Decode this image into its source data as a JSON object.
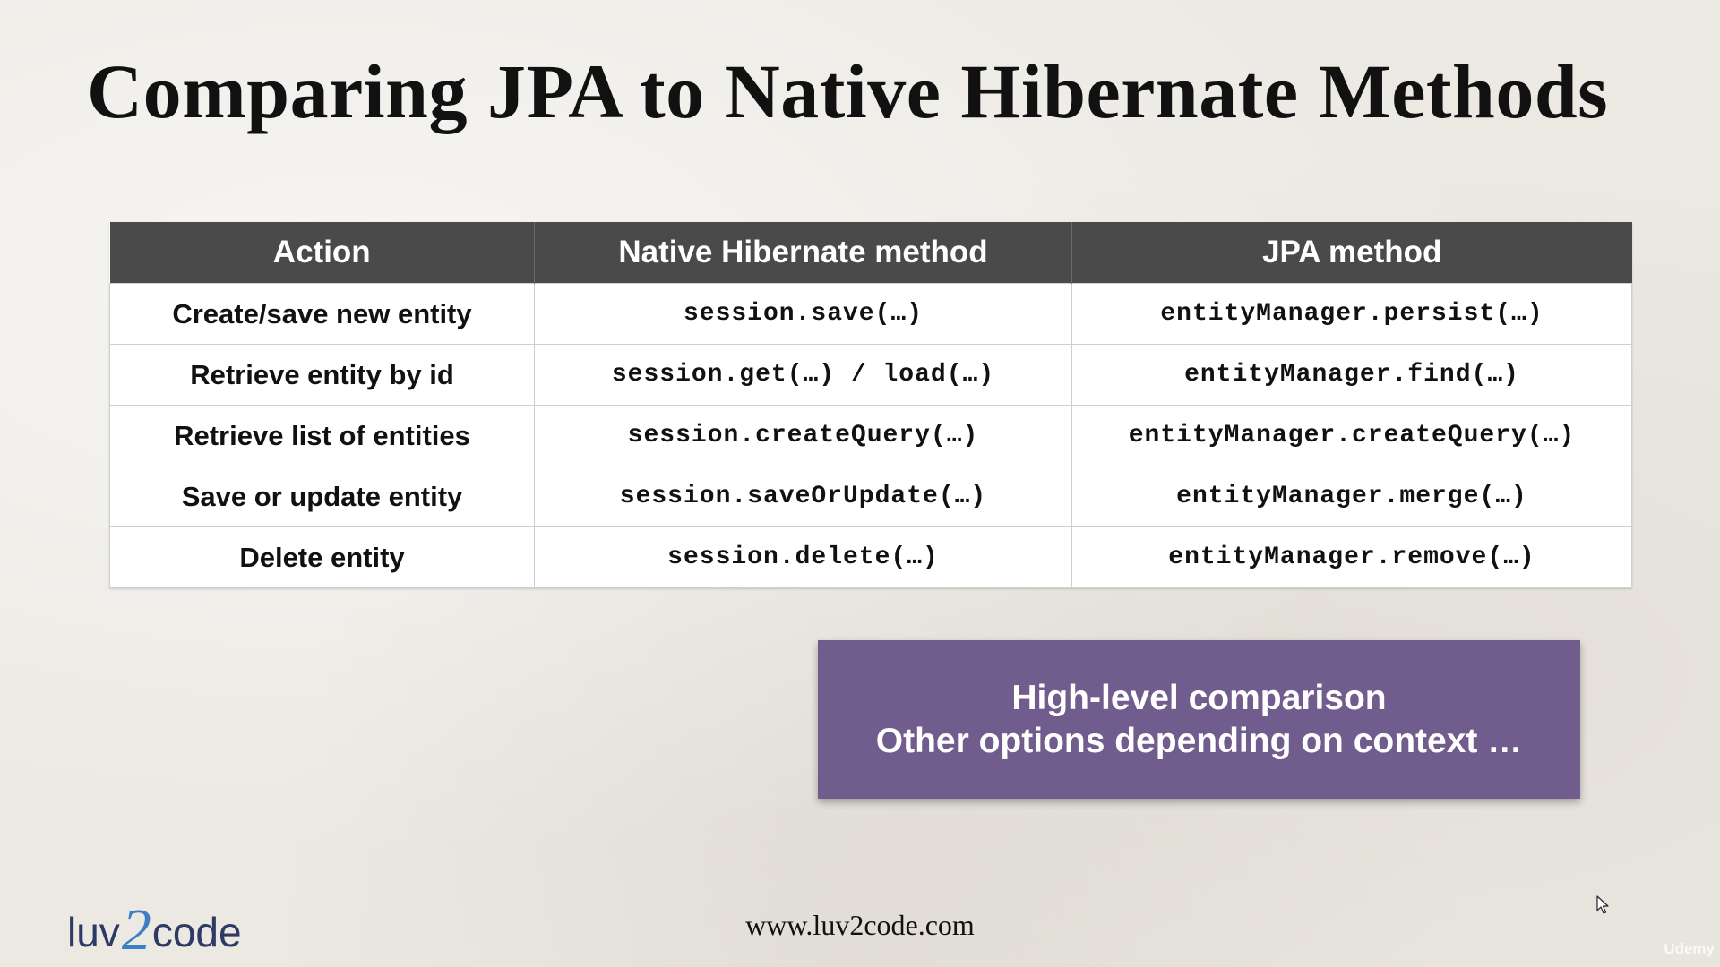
{
  "slide": {
    "title": "Comparing JPA to Native Hibernate Methods",
    "table": {
      "headers": [
        "Action",
        "Native Hibernate method",
        "JPA method"
      ],
      "rows": [
        [
          "Create/save new entity",
          "session.save(…)",
          "entityManager.persist(…)"
        ],
        [
          "Retrieve entity by id",
          "session.get(…) / load(…)",
          "entityManager.find(…)"
        ],
        [
          "Retrieve list of entities",
          "session.createQuery(…)",
          "entityManager.createQuery(…)"
        ],
        [
          "Save or update entity",
          "session.saveOrUpdate(…)",
          "entityManager.merge(…)"
        ],
        [
          "Delete entity",
          "session.delete(…)",
          "entityManager.remove(…)"
        ]
      ]
    },
    "callout": {
      "line1": "High-level comparison",
      "line2": "Other options depending on context …"
    },
    "footer": {
      "logo_part1": "luv",
      "logo_part2": "2",
      "logo_part3": "code",
      "url": "www.luv2code.com"
    },
    "watermark": "Udemy"
  },
  "colors": {
    "header_bg": "#4a4a4a",
    "callout_bg": "#715c8e",
    "logo_text": "#2d3a66",
    "logo_accent": "#3c7ec4"
  }
}
